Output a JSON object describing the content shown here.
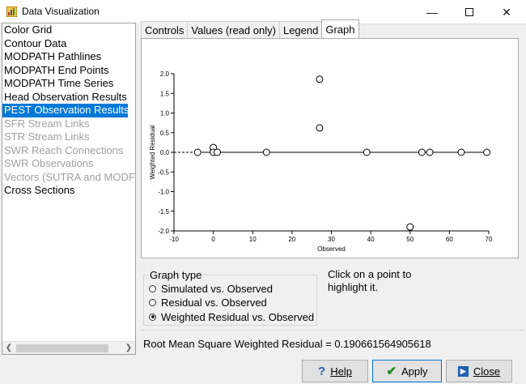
{
  "window": {
    "title": "Data Visualization"
  },
  "sidebar": {
    "items": [
      {
        "label": "Color Grid",
        "state": "enabled"
      },
      {
        "label": "Contour Data",
        "state": "enabled"
      },
      {
        "label": "MODPATH Pathlines",
        "state": "enabled"
      },
      {
        "label": "MODPATH End Points",
        "state": "enabled"
      },
      {
        "label": "MODPATH Time Series",
        "state": "enabled"
      },
      {
        "label": "Head Observation Results",
        "state": "enabled"
      },
      {
        "label": "PEST Observation Results",
        "state": "selected"
      },
      {
        "label": "SFR Stream Links",
        "state": "disabled"
      },
      {
        "label": "STR Stream Links",
        "state": "disabled"
      },
      {
        "label": "SWR Reach Connections",
        "state": "disabled"
      },
      {
        "label": "SWR Observations",
        "state": "disabled"
      },
      {
        "label": "Vectors (SUTRA and MODF",
        "state": "disabled"
      },
      {
        "label": "Cross Sections",
        "state": "enabled"
      }
    ]
  },
  "tabs": [
    {
      "label": "Controls",
      "active": false
    },
    {
      "label": "Values (read only)",
      "active": false
    },
    {
      "label": "Legend",
      "active": false
    },
    {
      "label": "Graph",
      "active": true
    }
  ],
  "chart_data": {
    "type": "scatter",
    "xlabel": "Observed",
    "ylabel": "Weighted Residual",
    "xlim": [
      -10,
      70
    ],
    "ylim": [
      -2.0,
      2.0
    ],
    "xticks": [
      -10,
      0,
      10,
      20,
      30,
      40,
      50,
      60,
      70
    ],
    "yticks": [
      -2.0,
      -1.5,
      -1.0,
      -0.5,
      0.0,
      0.5,
      1.0,
      1.5,
      2.0
    ],
    "ytick_labels": [
      "-2.0",
      "-1.5",
      "-1.0",
      "-0.5",
      "0.0",
      "0.5",
      "1.0",
      "1.5",
      "2.0"
    ],
    "points": [
      {
        "x": -4,
        "y": 0.0
      },
      {
        "x": 0,
        "y": 0.12
      },
      {
        "x": 0,
        "y": 0.0
      },
      {
        "x": 1,
        "y": 0.0
      },
      {
        "x": 13.5,
        "y": 0.0
      },
      {
        "x": 27,
        "y": 1.86
      },
      {
        "x": 27,
        "y": 0.62
      },
      {
        "x": 39,
        "y": 0.0
      },
      {
        "x": 50,
        "y": -1.9
      },
      {
        "x": 53,
        "y": 0.0
      },
      {
        "x": 55,
        "y": 0.0
      },
      {
        "x": 63,
        "y": 0.0
      },
      {
        "x": 69.5,
        "y": 0.0
      }
    ]
  },
  "graph_type": {
    "label": "Graph type",
    "options": [
      {
        "label": "Simulated vs. Observed",
        "selected": false
      },
      {
        "label": "Residual vs. Observed",
        "selected": false
      },
      {
        "label": "Weighted Residual vs. Observed",
        "selected": true
      }
    ]
  },
  "hint": "Click on a point to highlight it.",
  "rms_text": "Root Mean Square Weighted Residual = 0.190661564905618",
  "buttons": {
    "help": "Help",
    "apply": "Apply",
    "close": "Close"
  },
  "colors": {
    "selection": "#0078d7",
    "disabled_text": "#a0a0a0",
    "apply_icon": "#1a8a1a",
    "close_icon": "#1f5fb0"
  }
}
